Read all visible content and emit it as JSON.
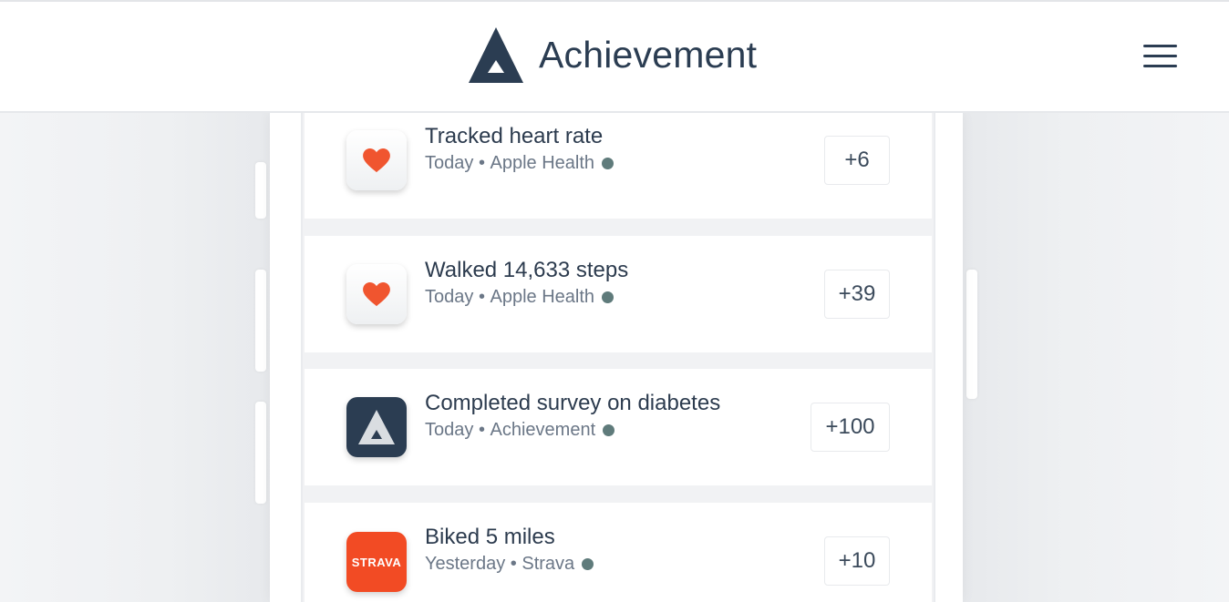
{
  "header": {
    "brand_name": "Achievement",
    "logo_icon": "achievement-triangle-icon",
    "menu_icon": "hamburger-menu-icon"
  },
  "colors": {
    "brand_navy": "#2b3d52",
    "heart_red": "#f0552f",
    "strava_orange": "#f24b24",
    "dot": "#5f7b7b",
    "background": "#f1f2f4"
  },
  "feed": {
    "items": [
      {
        "title": "Tracked heart rate",
        "date": "Today",
        "separator": "•",
        "source": "Apple Health",
        "points": "+6",
        "icon": "heart-icon"
      },
      {
        "title": "Walked 14,633 steps",
        "date": "Today",
        "separator": "•",
        "source": "Apple Health",
        "points": "+39",
        "icon": "heart-icon"
      },
      {
        "title": "Completed survey on diabetes",
        "date": "Today",
        "separator": "•",
        "source": "Achievement",
        "points": "+100",
        "icon": "achievement-triangle-icon"
      },
      {
        "title": "Biked 5 miles",
        "date": "Yesterday",
        "separator": "•",
        "source": "Strava",
        "points": "+10",
        "icon": "strava-icon",
        "icon_text": "STRAVA"
      }
    ]
  }
}
